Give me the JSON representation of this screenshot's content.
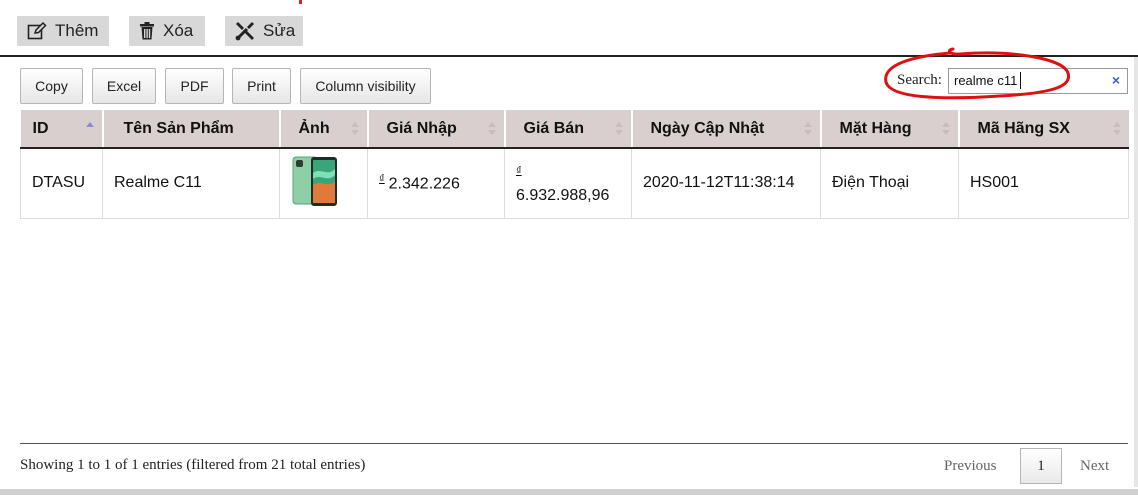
{
  "toolbar": {
    "add_label": "Thêm",
    "delete_label": "Xóa",
    "edit_label": "Sửa"
  },
  "export_buttons": {
    "copy": "Copy",
    "excel": "Excel",
    "pdf": "PDF",
    "print": "Print",
    "colvis": "Column visibility"
  },
  "search": {
    "label": "Search:",
    "value": "realme c11",
    "clear": "×"
  },
  "table": {
    "columns": [
      "ID",
      "Tên Sản Phẩm",
      "Ảnh",
      "Giá Nhập",
      "Giá Bán",
      "Ngày Cập Nhật",
      "Mặt Hàng",
      "Mã Hãng SX"
    ],
    "sorted_column": "ID",
    "rows": [
      {
        "id": "DTASU",
        "name": "Realme C11",
        "image": "phone-image",
        "currency": "₫",
        "price_in": "2.342.226",
        "price_out": "6.932.988,96",
        "updated": "2020-11-12T11:38:14",
        "category": "Điện Thoại",
        "manufacturer": "HS001"
      }
    ]
  },
  "footer": {
    "info": "Showing 1 to 1 of 1 entries (filtered from 21 total entries)",
    "previous": "Previous",
    "page": "1",
    "next": "Next"
  },
  "colors": {
    "header_bg": "#d9cfcf",
    "toolbar_bg": "#d8d8d8",
    "annotation_red": "#dd1111",
    "clear_blue": "#3a5fcd"
  }
}
